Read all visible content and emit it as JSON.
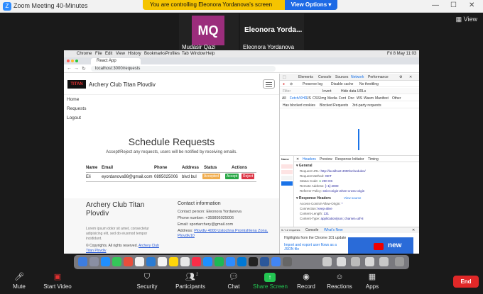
{
  "zoom": {
    "window_title": "Zoom Meeting 40-Minutes",
    "banner_text": "You are controlling Eleonora Yordanova's screen",
    "view_options": "View Options",
    "view_label": "View",
    "participants": [
      {
        "initials": "MQ",
        "name": "Mudasir Qazi"
      },
      {
        "display": "Eleonora Yorda...",
        "name": "Eleonora Yordanova"
      }
    ],
    "toolbar": {
      "mute": "Mute",
      "start_video": "Start Video",
      "security": "Security",
      "participants": "Participants",
      "participants_count": "2",
      "chat": "Chat",
      "share_screen": "Share Screen",
      "record": "Record",
      "reactions": "Reactions",
      "apps": "Apps",
      "end": "End"
    }
  },
  "mac": {
    "menu": [
      "Chrome",
      "File",
      "Edit",
      "View",
      "History",
      "Bookmarks",
      "Profiles",
      "Tab",
      "Window",
      "Help"
    ],
    "clock": "Fri 8 May 11:03"
  },
  "browser": {
    "tab_title": "React App",
    "url": "localhost:3000/requests"
  },
  "app": {
    "brand": "Archery Club Titan Plovdiv",
    "logo_text": "TITAN",
    "nav": [
      "Home",
      "Requests",
      "Logout"
    ],
    "page_title": "Schedule Requests",
    "subtitle": "Accept/Reject any requests, users will be notified by receiving emails.",
    "table": {
      "headers": [
        "Name",
        "Email",
        "Phone",
        "Address",
        "Status",
        "Actions"
      ],
      "rows": [
        {
          "name": "Eli",
          "email": "eyordanova98@gmail.com",
          "phone": "0895025006",
          "address": "blvd bul",
          "status": "Accepted",
          "accept": "Accept",
          "reject": "Reject"
        }
      ]
    },
    "footer": {
      "title": "Archery Club Titan Plovdiv",
      "lorem": "Lorem ipsum dolor sit amet, consectetur adipisicing elit, sed do eiusmod tempor incididunt.",
      "copyright_prefix": "© Copyrights. All rights reserved.",
      "copyright_link": "Archery Club Titan Plovdiv",
      "contact_title": "Contact information",
      "contact_person": "Contact person: Eleonora Yordanova",
      "phone": "Phone number: +359895025006",
      "email": "Email: sportarchery@gmail.com",
      "address_prefix": "Address:",
      "address_link": "Plovdiv 4000 Ustochna Promishlena Zona, Plovdiv10"
    }
  },
  "devtools": {
    "tabs": [
      "Elements",
      "Console",
      "Sources",
      "Network",
      "Performance"
    ],
    "filter_label": "Filter",
    "filters": [
      "All",
      "Fetch/XHR",
      "JS",
      "CSS",
      "Img",
      "Media",
      "Font",
      "Doc",
      "WS",
      "Wasm",
      "Manifest",
      "Other"
    ],
    "checkboxes": [
      "Invert",
      "Hide data URLs",
      "Has blocked cookies",
      "Blocked Requests",
      "3rd-party requests"
    ],
    "options": [
      "Preserve log",
      "Disable cache",
      "No throttling"
    ],
    "list_header": "Name",
    "detail_tabs": [
      "Headers",
      "Preview",
      "Response",
      "Initiator",
      "Timing"
    ],
    "general_title": "General",
    "general": [
      {
        "k": "Request URL:",
        "v": "http://localhost:4000/schedules/"
      },
      {
        "k": "Request Method:",
        "v": "GET"
      },
      {
        "k": "Status Code:",
        "v": "200 OK"
      },
      {
        "k": "Remote Address:",
        "v": "[::1]:4000"
      },
      {
        "k": "Referrer Policy:",
        "v": "strict-origin-when-cross-origin"
      }
    ],
    "response_headers_title": "Response Headers",
    "view_source": "View source",
    "response_headers": [
      {
        "k": "Access-Control-Allow-Origin:",
        "v": "*"
      },
      {
        "k": "Connection:",
        "v": "keep-alive"
      },
      {
        "k": "Content-Length:",
        "v": "131"
      },
      {
        "k": "Content-Type:",
        "v": "application/json; charset=utf-8"
      }
    ],
    "requests_status": "5 / 12 requests",
    "drawer_tabs": [
      "Console",
      "What's New"
    ],
    "highlights": "Highlights from the Chrome 101 update",
    "whatsnew_lines": [
      "Import and export user flows as a JSON file",
      "Import and export user flows and JSON file in the Recorder panel.",
      "View @layer at-rules in the Styles pane"
    ],
    "downloads": "Downloads",
    "new_label": "new"
  },
  "colors": {
    "banner": "#f5c400",
    "share_green": "#23c552",
    "end_red": "#e02828",
    "avatar_purple": "#9b2d7c"
  }
}
